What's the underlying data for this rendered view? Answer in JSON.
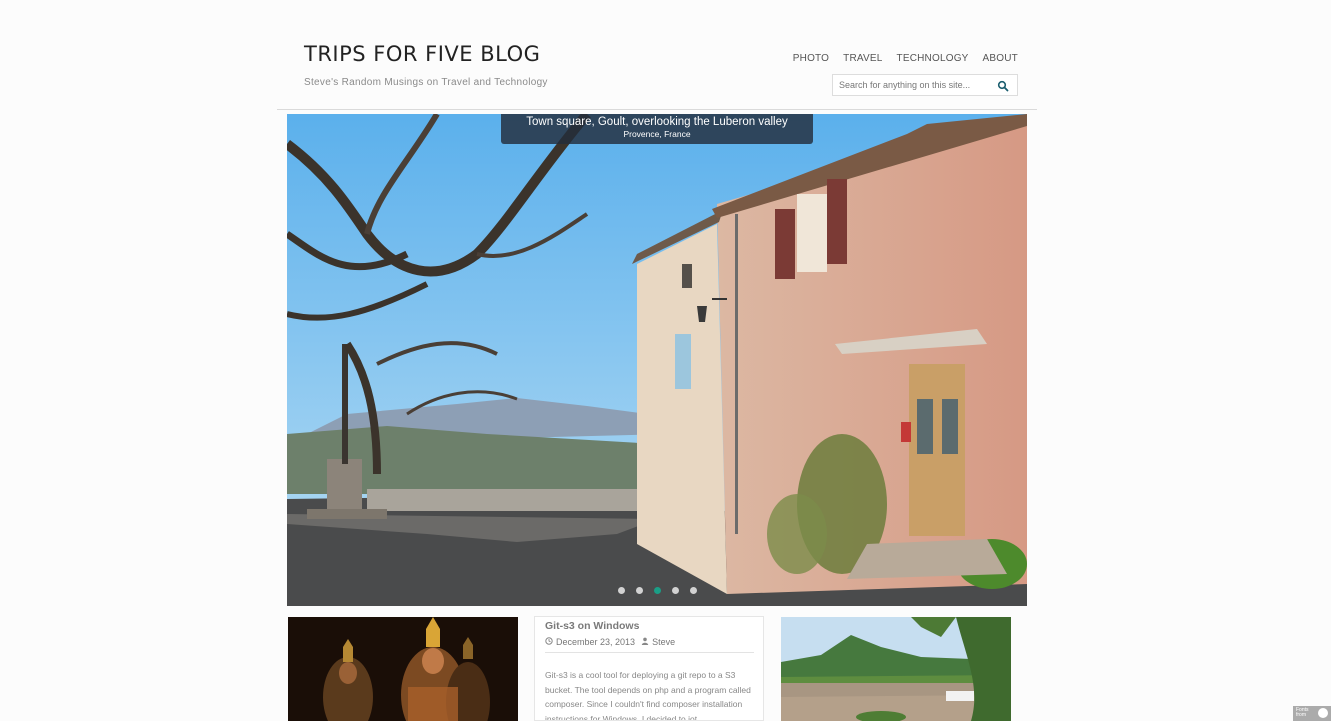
{
  "site": {
    "title": "TRIPS FOR FIVE BLOG",
    "tagline": "Steve's Random Musings on Travel and Technology"
  },
  "nav": {
    "items": [
      {
        "label": "PHOTO"
      },
      {
        "label": "TRAVEL"
      },
      {
        "label": "TECHNOLOGY"
      },
      {
        "label": "ABOUT"
      }
    ]
  },
  "search": {
    "placeholder": "Search for anything on this site...",
    "icon": "search-icon"
  },
  "slider": {
    "caption_title": "Town square, Goult, overlooking the Luberon valley",
    "caption_sub": "Provence, France",
    "slide_count": 5,
    "active_slide": 3
  },
  "post": {
    "title": "Git-s3 on Windows",
    "date": "December 23, 2013",
    "author": "Steve",
    "date_icon": "clock-icon",
    "author_icon": "user-icon",
    "excerpt": "Git-s3 is a cool tool for deploying a git repo to a S3 bucket.  The tool depends on php and a program called composer. Since I couldn't find composer installation instructions for Windows, I decided to jot"
  },
  "badge": {
    "line1": "Fonts",
    "line2": "from"
  },
  "colors": {
    "accent": "#1a9e86",
    "title": "#222222",
    "caption_bg": "#232d3c"
  }
}
